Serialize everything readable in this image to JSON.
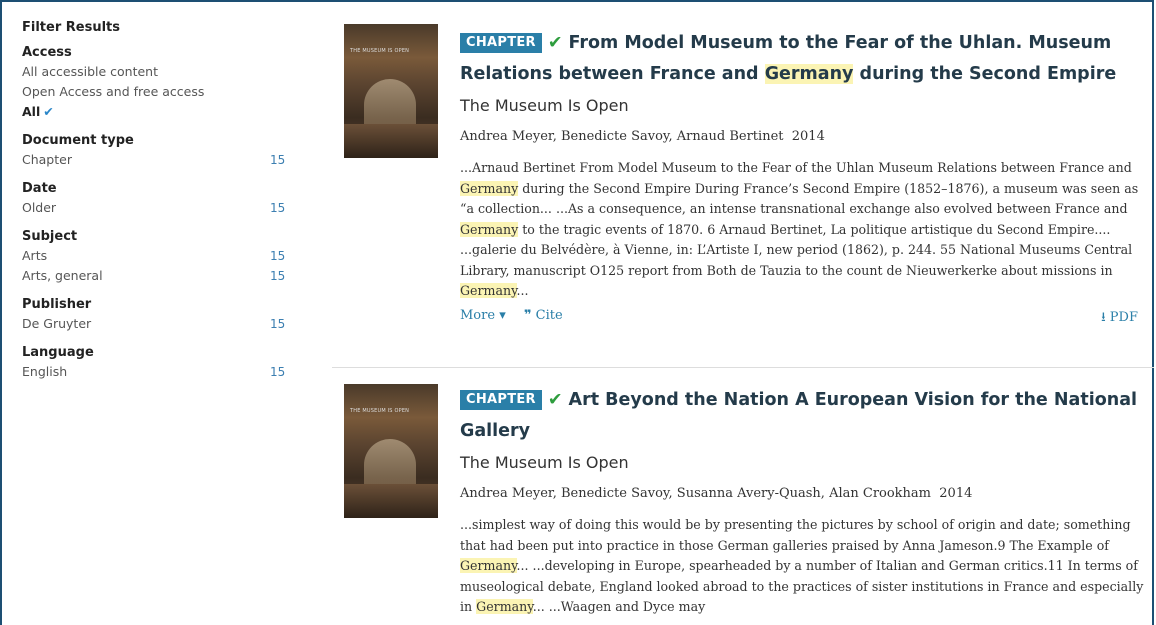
{
  "sidebar": {
    "title": "Filter Results",
    "access": {
      "heading": "Access",
      "options": [
        "All accessible content",
        "Open Access and free access"
      ],
      "active": "All",
      "active_check": "✔"
    },
    "document_type": {
      "heading": "Document type",
      "items": [
        {
          "label": "Chapter",
          "count": "15"
        }
      ]
    },
    "date": {
      "heading": "Date",
      "items": [
        {
          "label": "Older",
          "count": "15"
        }
      ]
    },
    "subject": {
      "heading": "Subject",
      "items": [
        {
          "label": "Arts",
          "count": "15"
        },
        {
          "label": "Arts, general",
          "count": "15"
        }
      ]
    },
    "publisher": {
      "heading": "Publisher",
      "items": [
        {
          "label": "De Gruyter",
          "count": "15"
        }
      ]
    },
    "language": {
      "heading": "Language",
      "items": [
        {
          "label": "English",
          "count": "15"
        }
      ]
    }
  },
  "results": [
    {
      "badge": "CHAPTER",
      "title_a": "From Model Museum to the Fear of the Uhlan. Museum Relations between France and ",
      "title_hl": "Germany",
      "title_b": " during the Second Empire",
      "book": "The Museum Is Open",
      "authors": "Andrea Meyer, Benedicte Savoy, Arnaud Bertinet",
      "year": "2014",
      "snippet_1": "...Arnaud Bertinet From Model Museum to the Fear of the Uhlan Museum Relations between France and ",
      "snippet_hl1": "Germany",
      "snippet_2": " during the Second Empire During France’s Second Empire (1852–1876), a museum was seen as “a collection... ...As a consequence, an intense transnational exchange also evolved between France and ",
      "snippet_hl2": "Germany",
      "snippet_3": " to the tragic events of 1870. 6  Arnaud Bertinet, La politique artistique du Second Empire.... ...galerie du Belvédère, à Vienne, in: L’Artiste I, new period (1862), p. 244. 55  National Museums Central Library, manuscript O125 report from Both de Tauzia to the count de Nieuwerkerke about missions in ",
      "snippet_hl3": "Germany",
      "snippet_4": "...",
      "more": "More",
      "cite": "Cite",
      "pdf": "PDF",
      "cover_title": "THE MUSEUM IS OPEN"
    },
    {
      "badge": "CHAPTER",
      "title_a": "Art Beyond the Nation A European Vision for the National Gallery",
      "title_hl": "",
      "title_b": "",
      "book": "The Museum Is Open",
      "authors": "Andrea Meyer, Benedicte Savoy, Susanna Avery-Quash, Alan Crookham",
      "year": "2014",
      "snippet_1": "...simplest way of doing this would be by presenting the pictures by school of origin and date; something that had been put into practice in those German galleries praised by Anna Jameson.9 The Example of ",
      "snippet_hl1": "Germany",
      "snippet_2": "... ...developing in Europe, spearheaded by a number of Italian and German critics.11 In terms of museological debate, England looked abroad to the practices of sister institutions in France and especially in ",
      "snippet_hl2": "Germany",
      "snippet_3": "... ...Waagen and Dyce may",
      "cover_title": "THE MUSEUM IS OPEN"
    }
  ],
  "colors": {
    "accent": "#2a7fa8",
    "highlight": "#fbf4b4",
    "check": "#2e9d3e",
    "border": "#1d4f73"
  }
}
